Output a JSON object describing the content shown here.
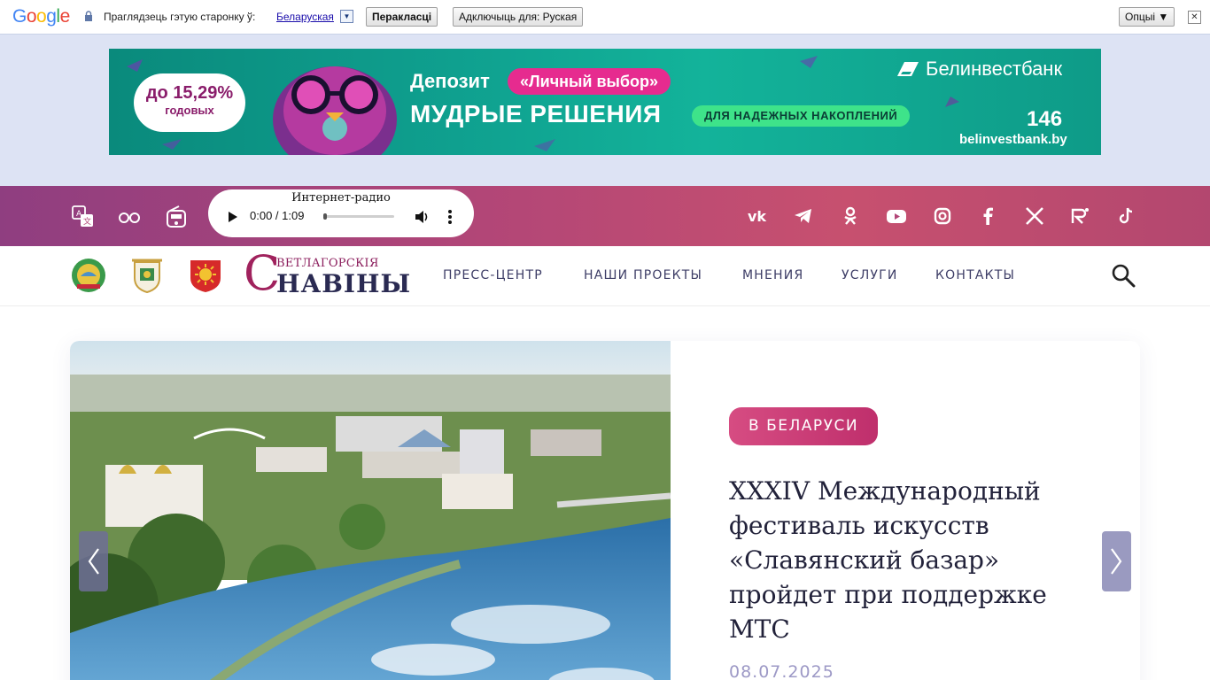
{
  "translate_bar": {
    "logo": "Google",
    "prompt": "Праглядзець гэтую старонку ў:",
    "language": "Беларуская",
    "translate_button": "Перакласці",
    "off_button": "Адключыць для: Руская",
    "options_button": "Опцыі ▼",
    "close_glyph": "✕"
  },
  "banner": {
    "rate": "до 15,29%",
    "rate_sub": "годовых",
    "deposit": "Депозит",
    "choice": "«Личный выбор»",
    "headline": "МУДРЫЕ РЕШЕНИЯ",
    "reliable": "ДЛЯ НАДЕЖНЫХ НАКОПЛЕНИЙ",
    "bank": "Белинвестбанк",
    "phone": "146",
    "site": "belinvestbank.by"
  },
  "topbar": {
    "tools": [
      "translate-icon",
      "glasses-icon",
      "radio-icon"
    ],
    "player": {
      "title": "Интернет-радио",
      "time": "0:00 / 1:09",
      "progress": 0
    },
    "socials": [
      "vk-icon",
      "telegram-icon",
      "odnoklassniki-icon",
      "youtube-icon",
      "instagram-icon",
      "facebook-icon",
      "x-icon",
      "rutube-icon",
      "tiktok-icon"
    ]
  },
  "header": {
    "logo_top": "ВЕТЛАГОРСКІЯ",
    "logo_main": "НАВІНЫ",
    "logo_letter": "С",
    "nav": [
      "ПРЕСС-ЦЕНТР",
      "НАШИ ПРОЕКТЫ",
      "МНЕНИЯ",
      "УСЛУГИ",
      "КОНТАКТЫ"
    ]
  },
  "hero": {
    "category": "В БЕЛАРУСИ",
    "title": "XXXIV Международный фестиваль искусств «Славянский базар» пройдет при поддержке МТС",
    "date": "08.07.2025"
  }
}
